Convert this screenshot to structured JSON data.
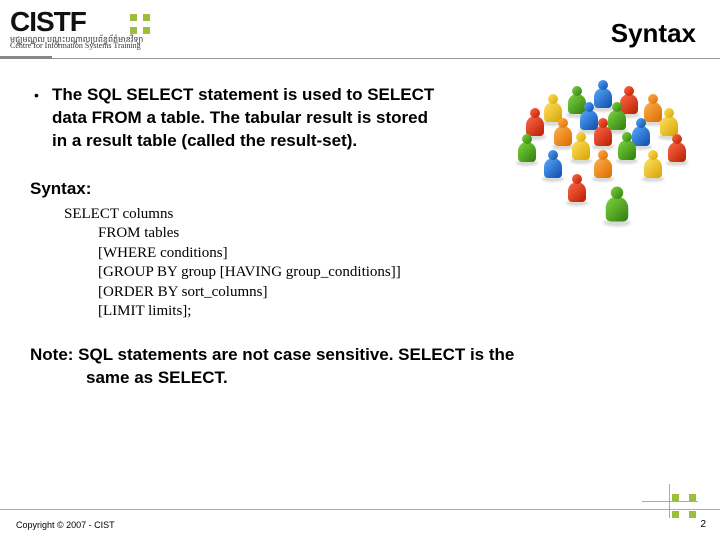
{
  "header": {
    "logo_text": "CISTF",
    "logo_subscript_km": "មជ្ឈមណ្ឌល   បណ្តុះបណ្តាលប្រព័ន្ធព័ត៌មានវិទ្យា",
    "logo_subscript_en": "Centre for   Information Systems Training",
    "title": "Syntax"
  },
  "body": {
    "bullet_text": "The SQL SELECT statement is used to SELECT data FROM a table. The tabular result is stored in a result table (called the result-set).",
    "syntax_label": "Syntax:",
    "syntax_lines": {
      "l0": "SELECT columns",
      "l1": "FROM tables",
      "l2": "[WHERE conditions]",
      "l3": "[GROUP BY group [HAVING group_conditions]]",
      "l4": "[ORDER BY sort_columns]",
      "l5": "[LIMIT limits];"
    },
    "note_label": "Note:",
    "note_body_line1": " SQL statements are not case sensitive. SELECT is the",
    "note_body_line2": "same as SELECT."
  },
  "footer": {
    "copyright": "Copyright © 2007 - CIST",
    "page_number": "2"
  },
  "illustration": {
    "alt": "crowd of colored game pawns"
  }
}
